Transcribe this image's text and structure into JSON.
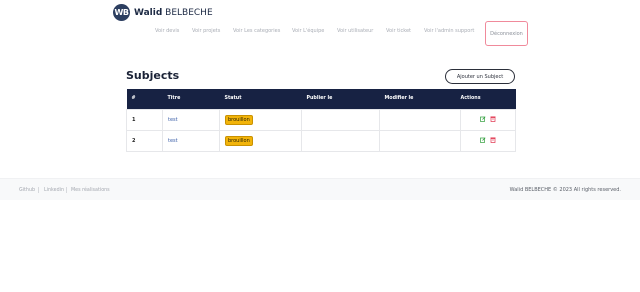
{
  "brand": {
    "logo_text": "WB",
    "name_bold": "Walid",
    "name_rest": " BELBECHE"
  },
  "nav": {
    "items": [
      {
        "label": "Voir devis"
      },
      {
        "label": "Voir projets"
      },
      {
        "label": "Voir Les categories"
      },
      {
        "label": "Voir L'équipe"
      },
      {
        "label": "Voir utilisateur"
      },
      {
        "label": "Voir ticket"
      },
      {
        "label": "Voir l'admin support"
      }
    ],
    "logout_label": "Déconnexion"
  },
  "main": {
    "title": "Subjects",
    "add_button_label": "Ajouter un Subject",
    "table": {
      "headers": [
        "#",
        "Titre",
        "Statut",
        "Publier le",
        "Modifier le",
        "Actions"
      ],
      "rows": [
        {
          "id": "1",
          "title": "test",
          "status": "brouillon",
          "published": "",
          "modified": ""
        },
        {
          "id": "2",
          "title": "test",
          "status": "brouillon",
          "published": "",
          "modified": ""
        }
      ]
    }
  },
  "footer": {
    "links": [
      {
        "label": "Github"
      },
      {
        "label": "Linkedin"
      },
      {
        "label": "Mes réalisations"
      }
    ],
    "copyright": "Walid BELBECHE © 2023 All rights reserved."
  },
  "colors": {
    "table_header_bg": "#172243",
    "badge_bg": "#f2b40a",
    "edit_icon": "#2e9d3a",
    "delete_icon": "#e0304a",
    "logout_border": "#f08a9b"
  }
}
